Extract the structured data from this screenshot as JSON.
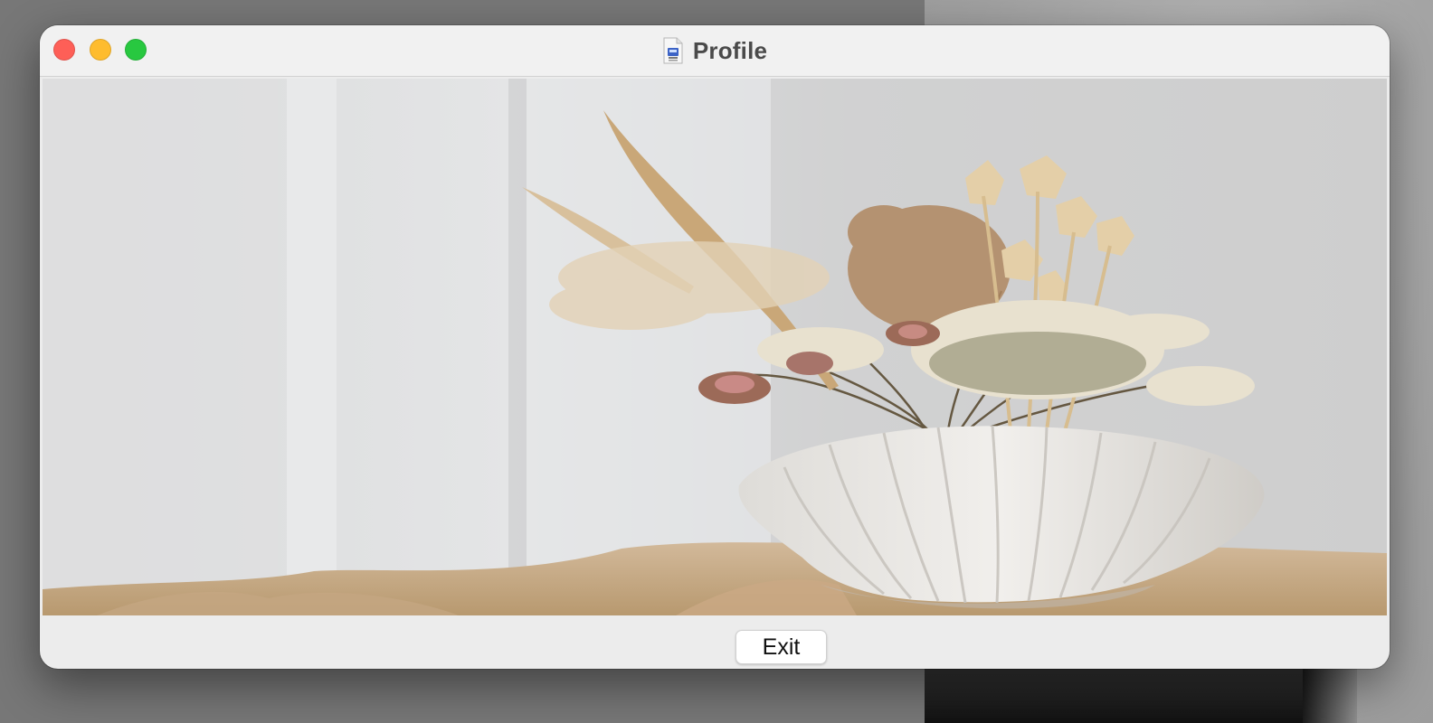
{
  "window": {
    "title": "Profile",
    "title_icon": "document-icon"
  },
  "traffic_lights": {
    "close_color": "#fe5f57",
    "minimize_color": "#febc2e",
    "zoom_color": "#28c840"
  },
  "image": {
    "subject": "dried-flowers-in-shell-vase"
  },
  "footer": {
    "exit_label": "Exit"
  }
}
